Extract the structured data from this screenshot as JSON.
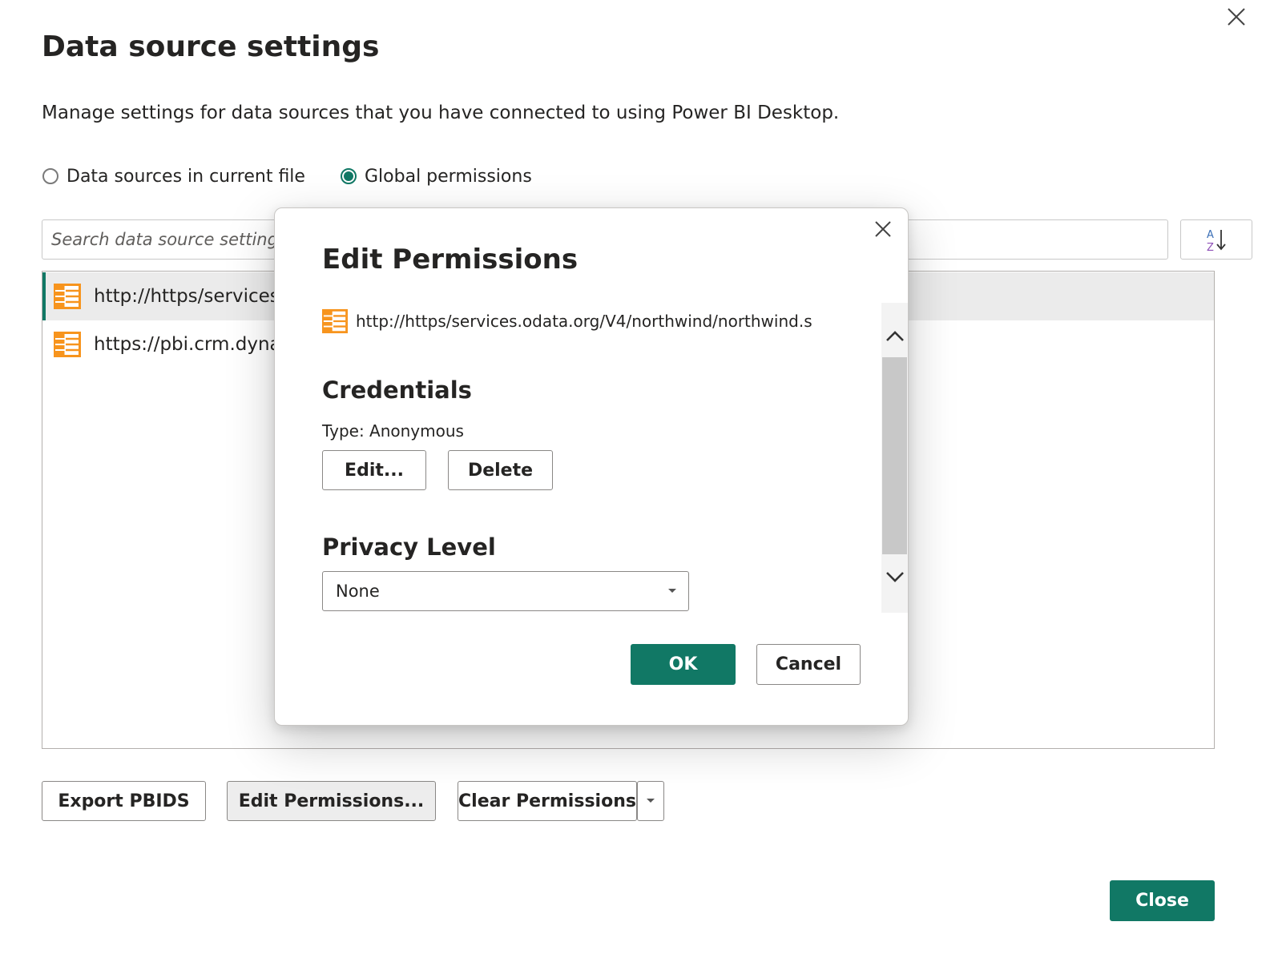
{
  "dialog": {
    "title": "Data source settings",
    "description": "Manage settings for data sources that you have connected to using Power BI Desktop.",
    "scope_options": [
      {
        "label": "Data sources in current file",
        "selected": false
      },
      {
        "label": "Global permissions",
        "selected": true
      }
    ],
    "search": {
      "placeholder": "Search data source settings",
      "value": ""
    },
    "sort_icon": "sort-az-icon",
    "data_sources": [
      {
        "label": "http://https/services",
        "icon": "table-icon",
        "selected": true
      },
      {
        "label": "https://pbi.crm.dyna",
        "icon": "table-icon",
        "selected": false
      }
    ],
    "buttons": {
      "export": "Export PBIDS",
      "edit_permissions": "Edit Permissions...",
      "clear_permissions": "Clear Permissions",
      "close": "Close"
    }
  },
  "edit_permissions_dialog": {
    "title": "Edit Permissions",
    "source_url": "http://https/services.odata.org/V4/northwind/northwind.s",
    "credentials": {
      "heading": "Credentials",
      "type_text": "Type: Anonymous",
      "edit_label": "Edit...",
      "delete_label": "Delete"
    },
    "privacy": {
      "heading": "Privacy Level",
      "selected": "None"
    },
    "ok_label": "OK",
    "cancel_label": "Cancel"
  },
  "colors": {
    "accent": "#117865",
    "source_icon": "#f7941d",
    "text": "#252423"
  }
}
